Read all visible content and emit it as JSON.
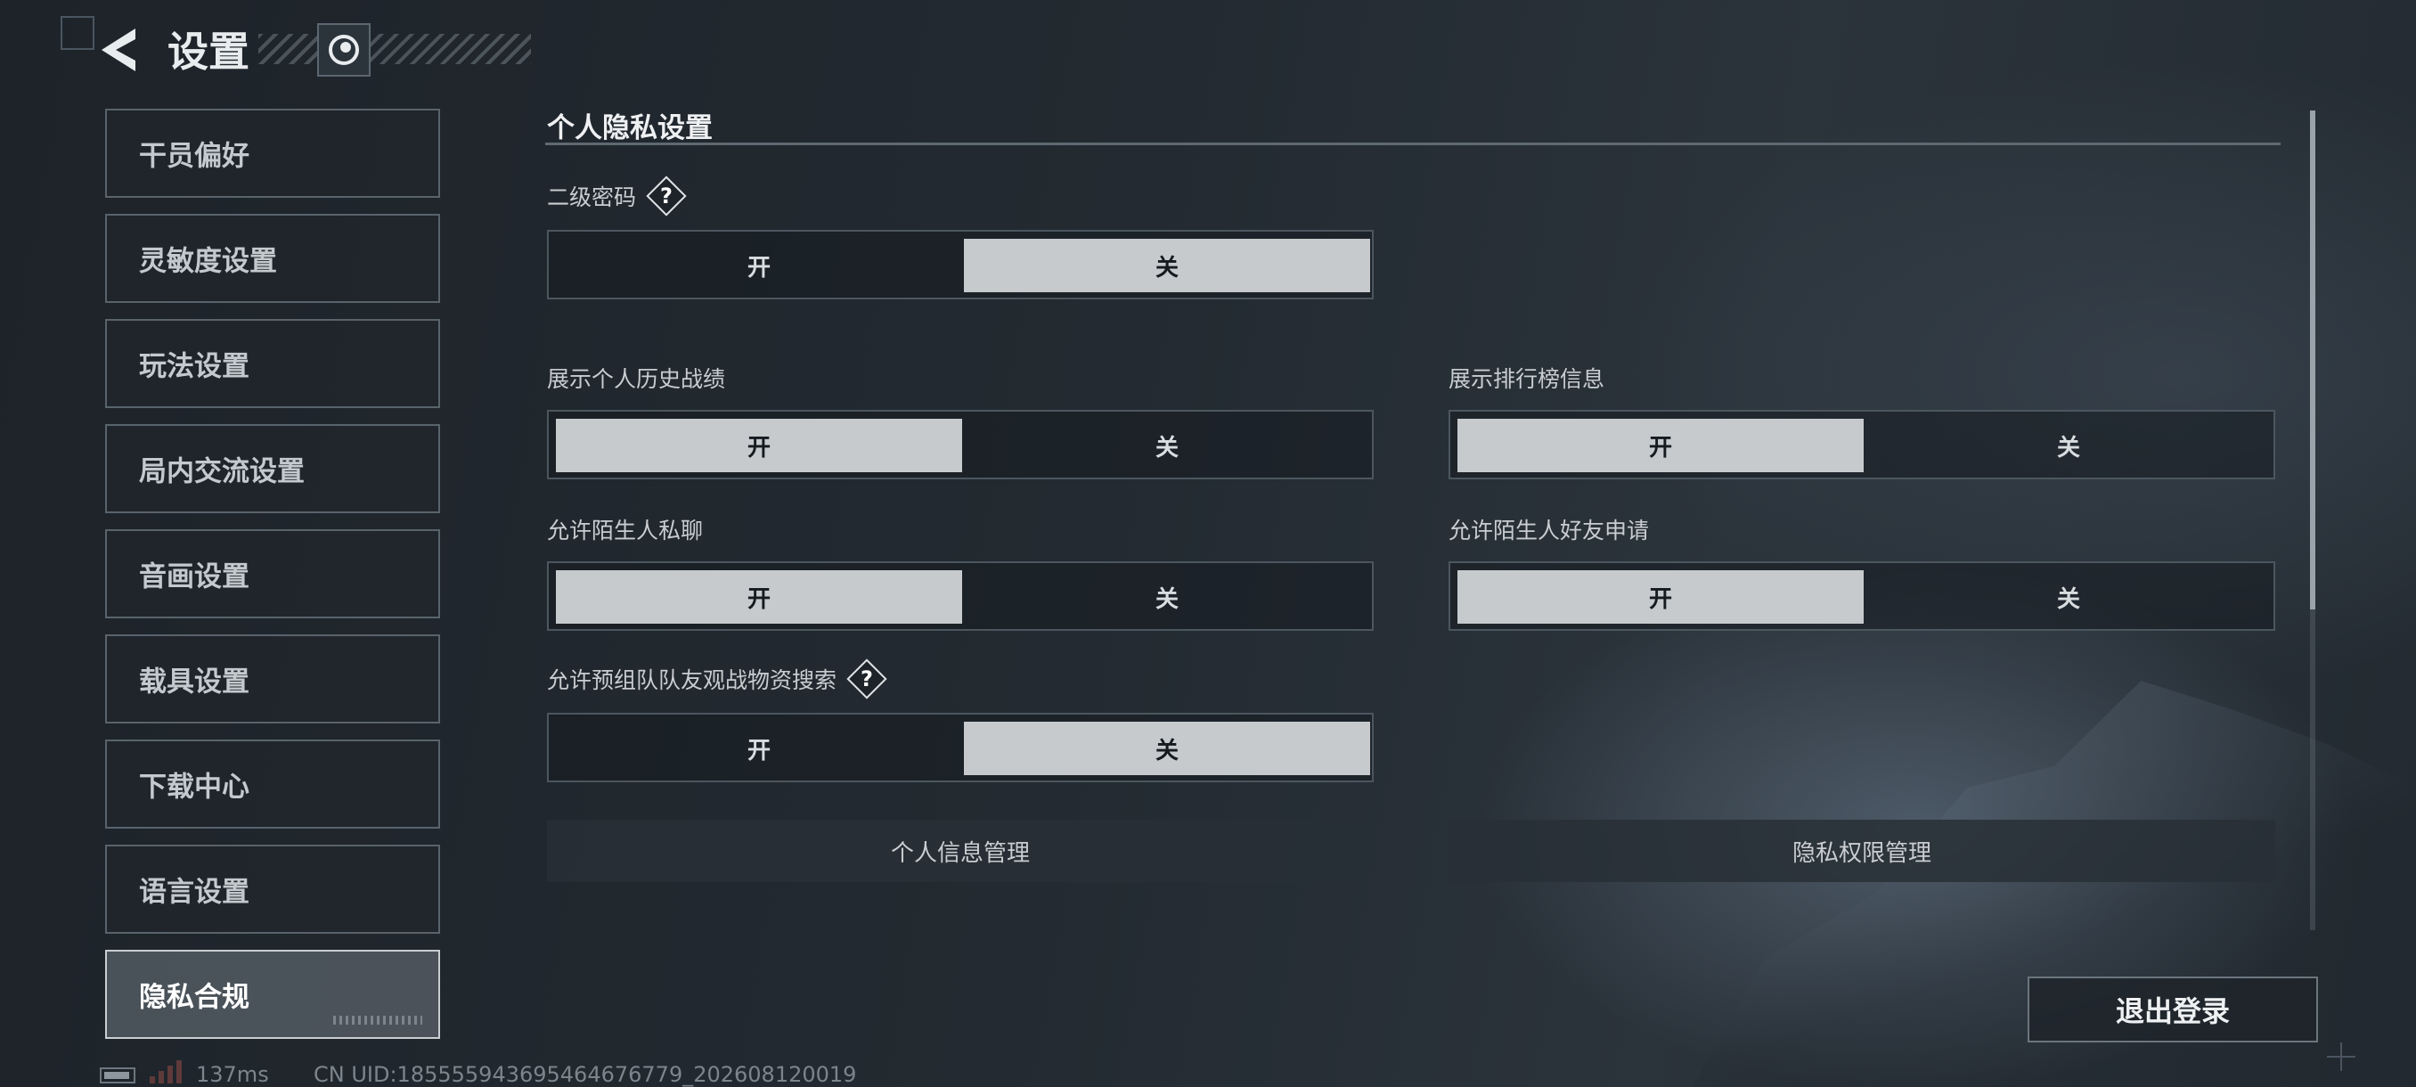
{
  "header": {
    "title": "设置"
  },
  "sidebar": {
    "items": [
      {
        "label": "干员偏好",
        "active": false
      },
      {
        "label": "灵敏度设置",
        "active": false
      },
      {
        "label": "玩法设置",
        "active": false
      },
      {
        "label": "局内交流设置",
        "active": false
      },
      {
        "label": "音画设置",
        "active": false
      },
      {
        "label": "载具设置",
        "active": false
      },
      {
        "label": "下载中心",
        "active": false
      },
      {
        "label": "语言设置",
        "active": false
      },
      {
        "label": "隐私合规",
        "active": true
      }
    ]
  },
  "main": {
    "section_title": "个人隐私设置",
    "settings": {
      "secondary_password": {
        "label": "二级密码",
        "on": "开",
        "off": "关",
        "selected": "关"
      },
      "show_history": {
        "label": "展示个人历史战绩",
        "on": "开",
        "off": "关",
        "selected": "开"
      },
      "show_leaderboard": {
        "label": "展示排行榜信息",
        "on": "开",
        "off": "关",
        "selected": "开"
      },
      "stranger_chat": {
        "label": "允许陌生人私聊",
        "on": "开",
        "off": "关",
        "selected": "开"
      },
      "stranger_friend": {
        "label": "允许陌生人好友申请",
        "on": "开",
        "off": "关",
        "selected": "开"
      },
      "team_search": {
        "label": "允许预组队队友观战物资搜索",
        "on": "开",
        "off": "关",
        "selected": "关"
      }
    },
    "buttons": {
      "personal_info": "个人信息管理",
      "privacy_permissions": "隐私权限管理",
      "logout": "退出登录"
    }
  },
  "footer": {
    "ping": "137ms",
    "uid": "CN UID:18555594369546467677​9_202608120019"
  },
  "colors": {
    "selected_bg": "#c6cacd",
    "accent_text": "#eef0f2",
    "background": "#232a31"
  }
}
